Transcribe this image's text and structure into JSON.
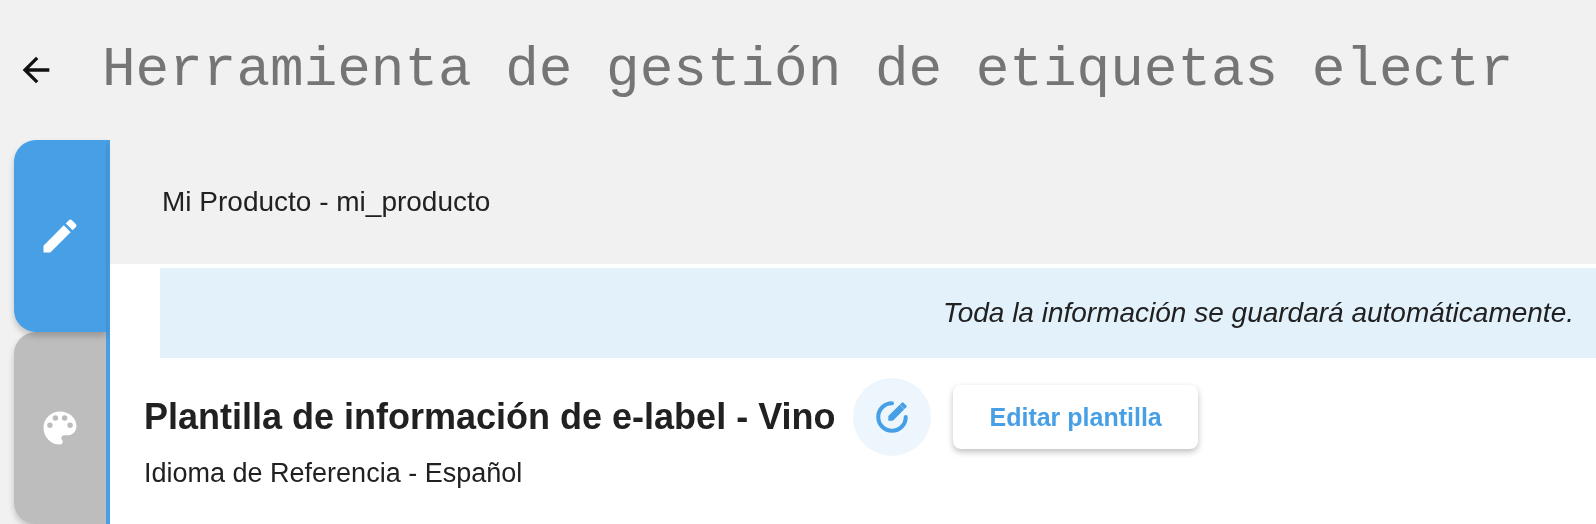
{
  "header": {
    "title": "Herramienta de gestión de etiquetas electr"
  },
  "tabs": [
    {
      "kind": "edit",
      "selected": true
    },
    {
      "kind": "palette",
      "selected": false
    }
  ],
  "product": {
    "name": "Mi Producto - mi_producto"
  },
  "notice": "Toda la información se guardará automáticamente.",
  "template": {
    "title": "Plantilla de información de e-label - Vino",
    "subtitle": "Idioma de Referencia - Español",
    "button": "Editar plantilla"
  }
}
